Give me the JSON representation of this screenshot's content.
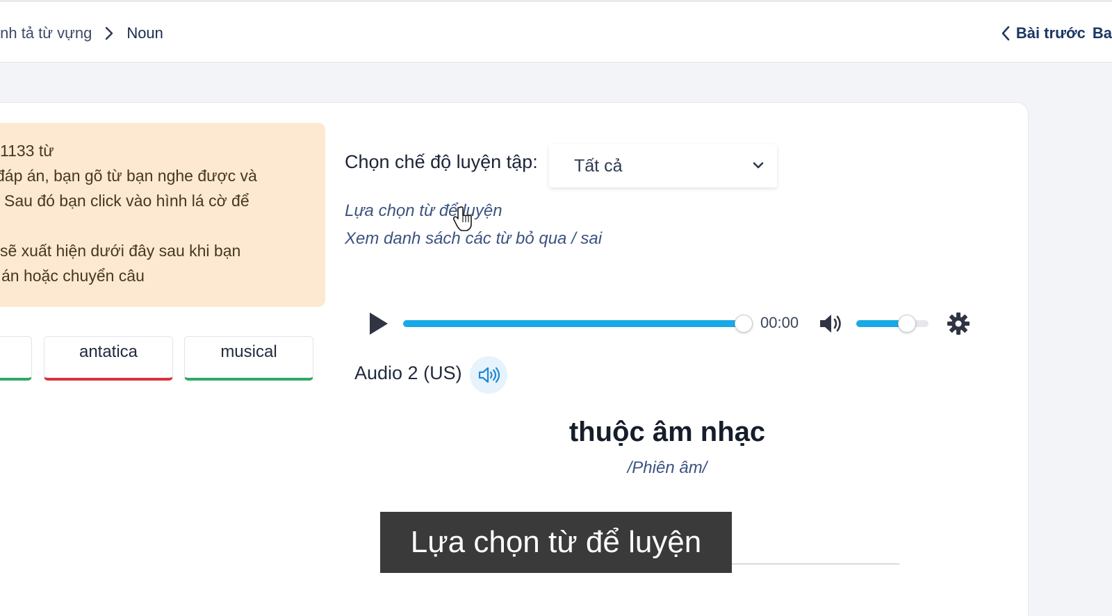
{
  "breadcrumb": {
    "parent": "ính tả từ vựng",
    "current": "Noun"
  },
  "nav": {
    "prev_label": "Bài trước",
    "next_label_partial": "Ba"
  },
  "instructions": {
    "line1": "1133 từ",
    "line2": "đáp án, bạn gõ từ bạn nghe được và",
    "line3": "Sau đó bạn click vào hình lá cờ để",
    "line4": "sẽ xuất hiện dưới đây sau khi bạn",
    "line5": "án hoặc chuyển câu"
  },
  "word_tiles": [
    {
      "label": "",
      "status": "correct",
      "color": "#2fa865"
    },
    {
      "label": "antatica",
      "status": "wrong",
      "color": "#d9323b"
    },
    {
      "label": "musical",
      "status": "correct",
      "color": "#2fa865"
    }
  ],
  "practice_mode": {
    "label": "Chọn chế độ luyện tập:",
    "selected": "Tất cả"
  },
  "links": {
    "choose_words": "Lựa chọn từ để luyện",
    "view_skipped": "Xem danh sách các từ bỏ qua / sai"
  },
  "player": {
    "time": "00:00",
    "progress": 1.0,
    "volume": 0.7,
    "accent_color": "#19a9e6"
  },
  "audio": {
    "label": "Audio 2 (US)"
  },
  "word": {
    "meaning": "thuộc âm nhạc",
    "phonetic": "/Phiên âm/"
  },
  "caption": {
    "text": "Lựa chọn từ để luyện"
  }
}
